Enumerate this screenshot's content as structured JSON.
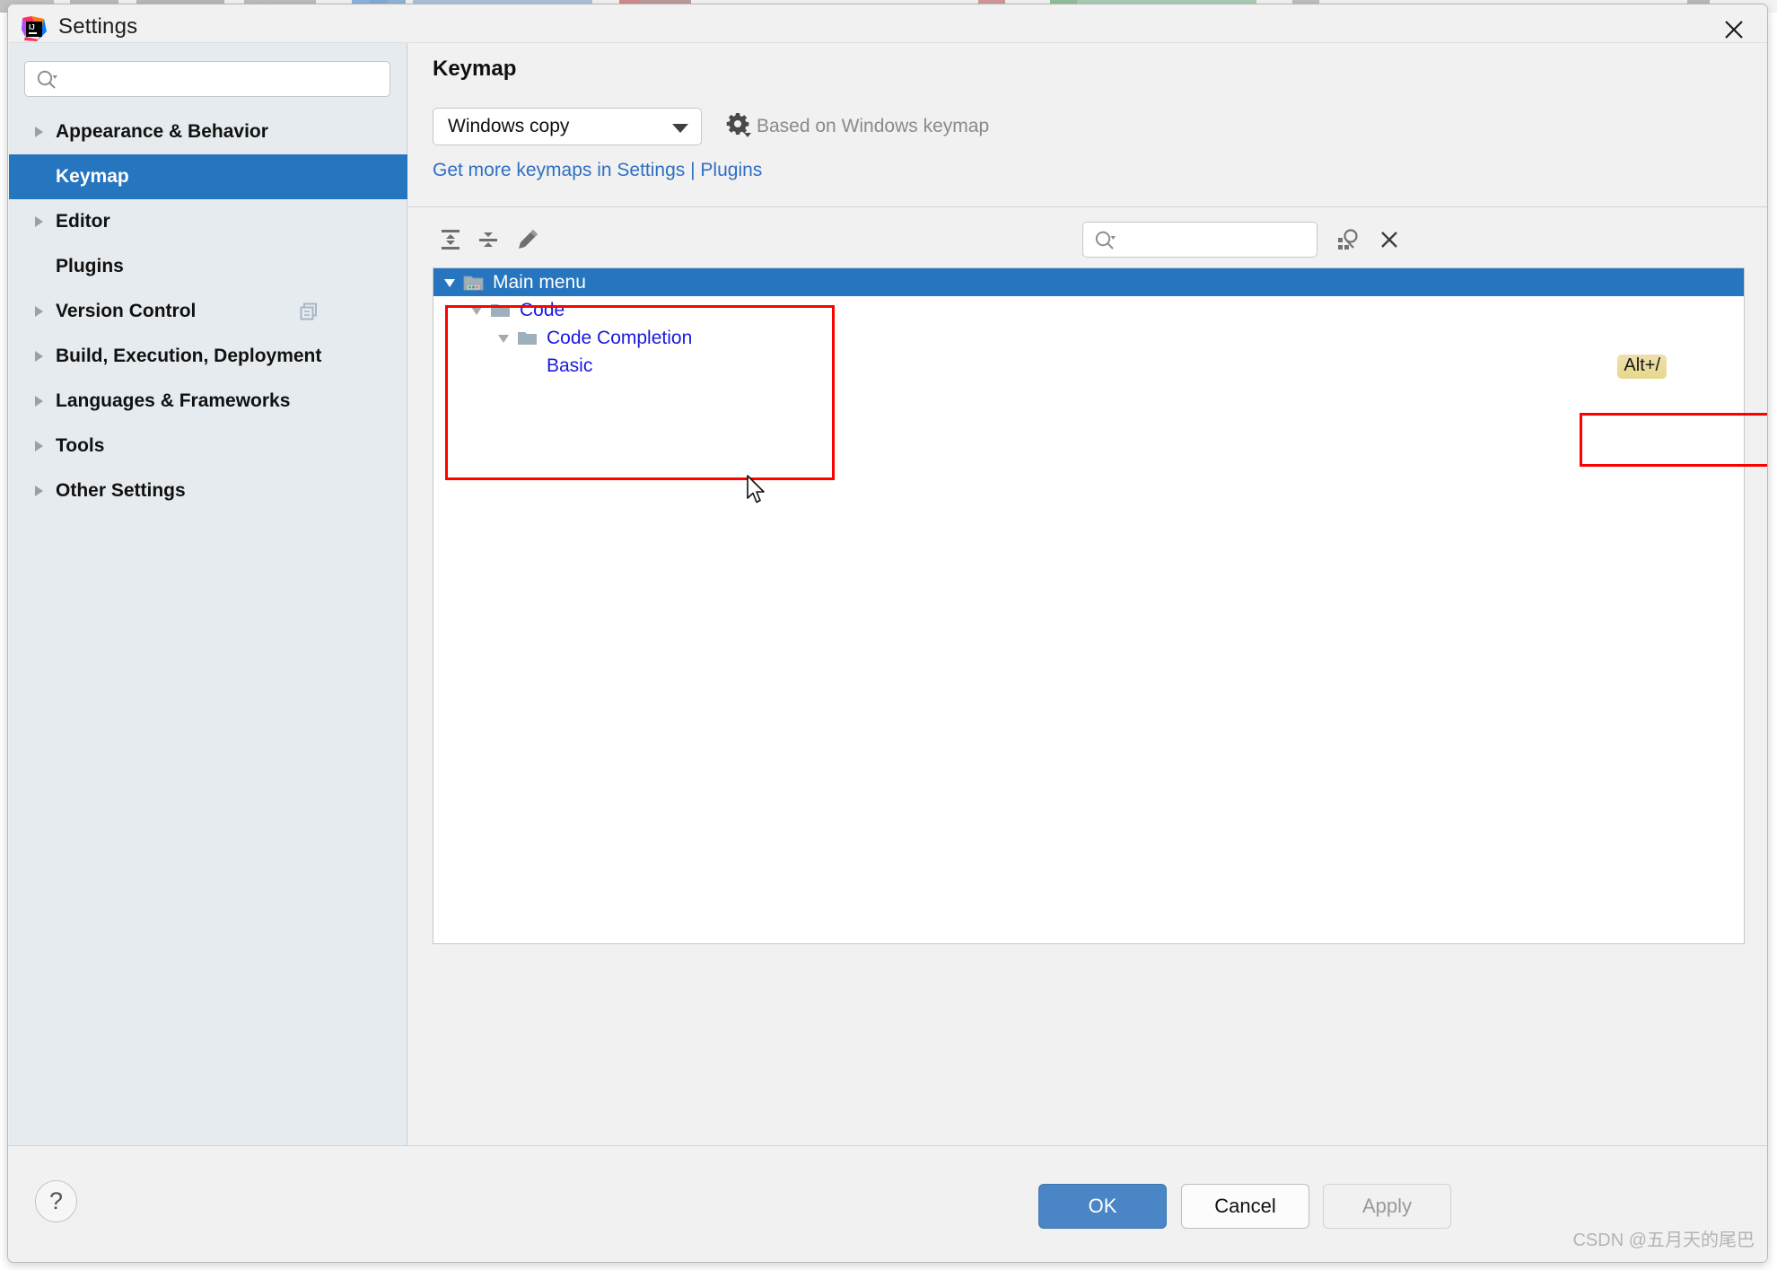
{
  "window": {
    "title": "Settings",
    "app_icon": "intellij-idea-icon",
    "close_icon": "close-icon"
  },
  "sidebar": {
    "search": {
      "value": "",
      "placeholder": "",
      "icon": "search-icon"
    },
    "items": [
      {
        "label": "Appearance & Behavior",
        "expandable": true,
        "selected": false
      },
      {
        "label": "Keymap",
        "expandable": false,
        "selected": true
      },
      {
        "label": "Editor",
        "expandable": true,
        "selected": false
      },
      {
        "label": "Plugins",
        "expandable": false,
        "selected": false
      },
      {
        "label": "Version Control",
        "expandable": true,
        "selected": false,
        "trailing_icon": "copy-icon"
      },
      {
        "label": "Build, Execution, Deployment",
        "expandable": true,
        "selected": false
      },
      {
        "label": "Languages & Frameworks",
        "expandable": true,
        "selected": false
      },
      {
        "label": "Tools",
        "expandable": true,
        "selected": false
      },
      {
        "label": "Other Settings",
        "expandable": true,
        "selected": false
      }
    ]
  },
  "main": {
    "page_title": "Keymap",
    "keymap_select": {
      "value": "Windows copy",
      "caret_icon": "chevron-down-icon"
    },
    "gear_icon": "gear-icon",
    "based_on": "Based on Windows keymap",
    "plugins_link": "Get more keymaps in Settings | Plugins",
    "toolbar": {
      "expand_all_icon": "expand-all-icon",
      "collapse_all_icon": "collapse-all-icon",
      "edit_icon": "pencil-edit-icon",
      "search": {
        "value": "",
        "placeholder": "",
        "icon": "search-icon"
      },
      "find_by_shortcut_icon": "find-by-shortcut-icon",
      "clear_icon": "close-icon"
    },
    "tree": [
      {
        "label": "Main menu",
        "depth": 0,
        "expanded": true,
        "selected": true,
        "icon": "main-menu-folder-icon",
        "shortcut": ""
      },
      {
        "label": "Code",
        "depth": 1,
        "expanded": true,
        "selected": false,
        "icon": "folder-icon",
        "shortcut": ""
      },
      {
        "label": "Code Completion",
        "depth": 2,
        "expanded": true,
        "selected": false,
        "icon": "folder-icon",
        "shortcut": ""
      },
      {
        "label": "Basic",
        "depth": 3,
        "expanded": false,
        "selected": false,
        "icon": "",
        "shortcut": "Alt+/"
      }
    ]
  },
  "footer": {
    "help_label": "?",
    "ok_label": "OK",
    "cancel_label": "Cancel",
    "apply_label": "Apply",
    "apply_enabled": false
  },
  "watermark": "CSDN @五月天的尾巴",
  "colors": {
    "accent_blue": "#2675bf",
    "primary_button": "#4a86c5",
    "tree_text_blue": "#1919e0",
    "link_blue": "#2f6fc4",
    "sidebar_bg": "#e6ebef",
    "shortcut_badge": "#e6d98b",
    "annotation_red": "#ff0000"
  }
}
